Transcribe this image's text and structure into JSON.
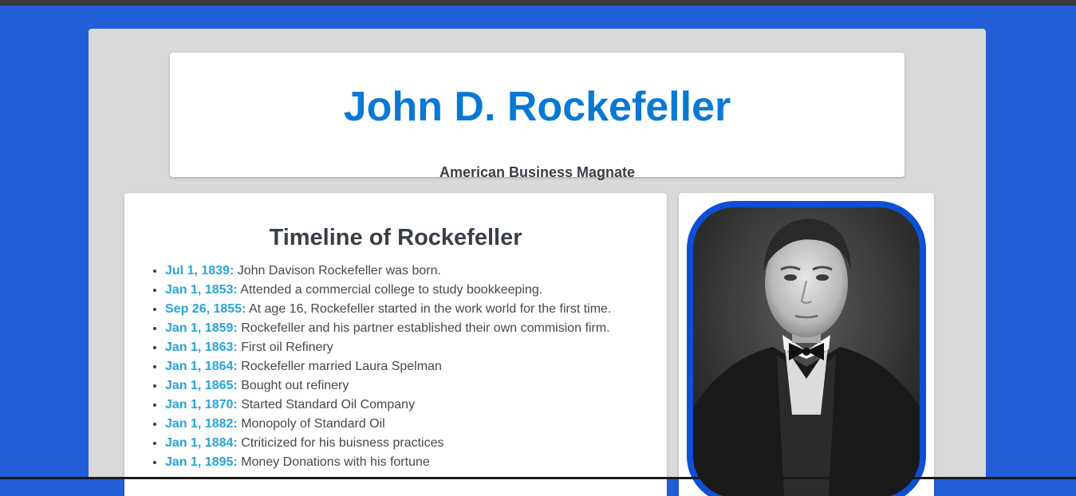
{
  "header": {
    "title": "John D. Rockefeller",
    "subtitle": "American Business Magnate"
  },
  "timeline": {
    "heading": "Timeline of Rockefeller",
    "items": [
      {
        "date": "Jul 1, 1839:",
        "event": "John Davison Rockefeller was born."
      },
      {
        "date": "Jan 1, 1853:",
        "event": "Attended a commercial college to study bookkeeping."
      },
      {
        "date": "Sep 26, 1855:",
        "event": "At age 16, Rockefeller started in the work world for the first time."
      },
      {
        "date": "Jan 1, 1859:",
        "event": "Rockefeller and his partner established their own commision firm."
      },
      {
        "date": "Jan 1, 1863:",
        "event": "First oil Refinery"
      },
      {
        "date": "Jan 1, 1864:",
        "event": "Rockefeller married Laura Spelman"
      },
      {
        "date": "Jan 1, 1865:",
        "event": "Bought out refinery"
      },
      {
        "date": "Jan 1, 1870:",
        "event": "Started Standard Oil Company"
      },
      {
        "date": "Jan 1, 1882:",
        "event": "Monopoly of Standard Oil"
      },
      {
        "date": "Jan 1, 1884:",
        "event": "Ctriticized for his buisness practices"
      },
      {
        "date": "Jan 1, 1895:",
        "event": "Money Donations with his fortune"
      }
    ]
  },
  "portrait": {
    "icon": "portrait-photo",
    "frame_color": "#0e4fd4"
  },
  "colors": {
    "background": "#225ed8",
    "title": "#0a78d4",
    "date": "#29a3d8",
    "text": "#3a3f47",
    "panel": "#d9d9d9"
  }
}
